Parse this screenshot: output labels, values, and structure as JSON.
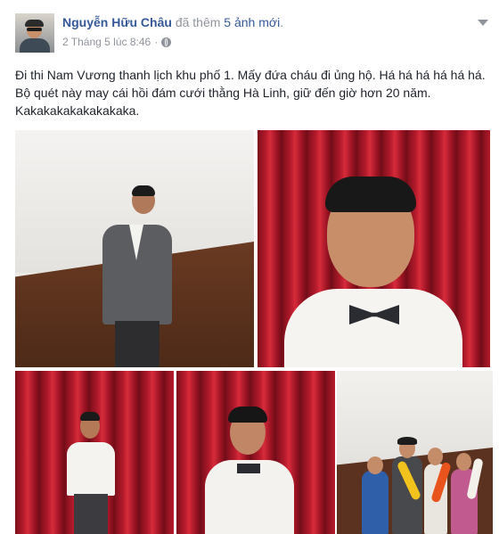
{
  "post": {
    "author": "Nguyễn Hữu Châu",
    "action": "đã thêm",
    "added_count": "5 ảnh mới",
    "timestamp": "2 Tháng 5 lúc 8:46",
    "separator": "·",
    "text": "Đi thi Nam Vương thanh lịch khu phố 1. Mấy đứa cháu đi ủng hộ. Há há há há há há. Bộ quét này may cái hồi đám cưới thằng Hà Linh, giữ đến giờ hơn 20 năm. Kakakakakakakakaka."
  },
  "icons": {
    "privacy": "globe-icon",
    "menu": "chevron-down-icon"
  },
  "colors": {
    "link": "#365899",
    "meta": "#90949c",
    "text": "#1d2129",
    "curtain": "#b21a2b"
  },
  "photos": [
    {
      "label": "photo-1"
    },
    {
      "label": "photo-2"
    },
    {
      "label": "photo-3"
    },
    {
      "label": "photo-4"
    },
    {
      "label": "photo-5"
    }
  ]
}
